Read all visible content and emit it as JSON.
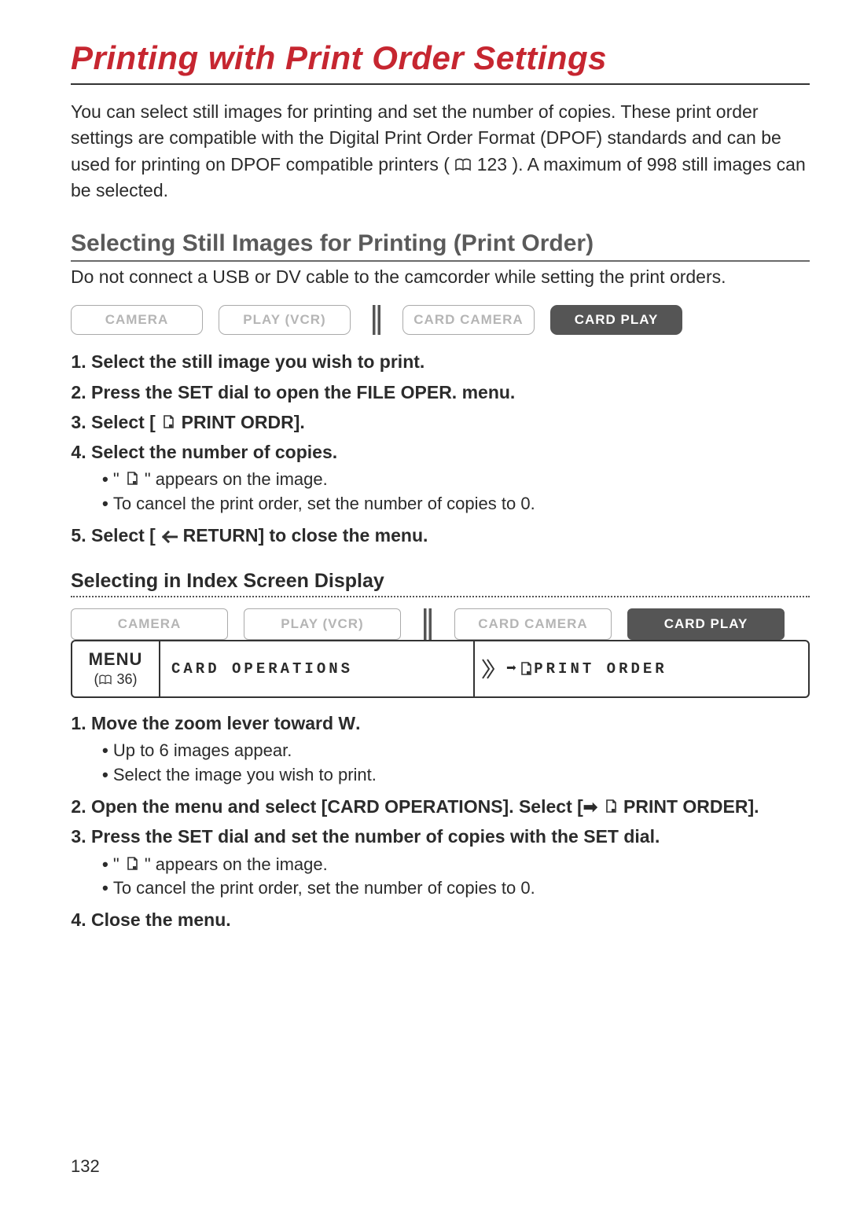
{
  "page_number": "132",
  "title": "Printing with Print Order Settings",
  "intro_parts": {
    "a": "You can select still images for printing and set the number of copies. These print order settings are compatible with the Digital Print Order Format (DPOF) standards and can be used for printing on DPOF compatible printers (",
    "ref": " 123",
    "b": "). A maximum of 998 still images can be selected."
  },
  "section1": {
    "heading": "Selecting Still Images for Printing (Print Order)",
    "sub": "Do not connect a USB or DV cable to the camcorder while setting the print orders.",
    "modes": {
      "m1": "CAMERA",
      "m2": "PLAY (VCR)",
      "m3": "CARD CAMERA",
      "m4": "CARD PLAY"
    },
    "steps": {
      "s1": "Select the still image you wish to print.",
      "s2": "Press the SET dial to open the FILE OPER. menu.",
      "s3_a": "Select [",
      "s3_b": " PRINT ORDR].",
      "s4": "Select the number of copies.",
      "s4_b1_a": "\" ",
      "s4_b1_b": " \" appears on the image.",
      "s4_b2": "To cancel the print order, set the number of copies to 0.",
      "s5_a": "Select [",
      "s5_b": " RETURN] to close the menu."
    }
  },
  "section2": {
    "heading": "Selecting in Index Screen Display",
    "modes": {
      "m1": "CAMERA",
      "m2": "PLAY (VCR)",
      "m3": "CARD CAMERA",
      "m4": "CARD PLAY"
    },
    "menu_path": {
      "menu_word": "MENU",
      "menu_ref": " 36)",
      "operations": "CARD OPERATIONS",
      "print_order": "PRINT ORDER"
    },
    "steps": {
      "s1_a": "Move the zoom lever toward ",
      "s1_w": "W",
      "s1_b": ".",
      "s1_b1": "Up to 6 images appear.",
      "s1_b2": "Select the image you wish to print.",
      "s2_a": "Open the menu and select [CARD OPERATIONS]. Select [",
      "s2_b": " PRINT ORDER].",
      "s3": "Press the SET dial and set the number of copies with the SET dial.",
      "s3_b1_a": "\" ",
      "s3_b1_b": " \" appears on the image.",
      "s3_b2": "To cancel the print order, set the number of copies to 0.",
      "s4": "Close the menu."
    }
  }
}
